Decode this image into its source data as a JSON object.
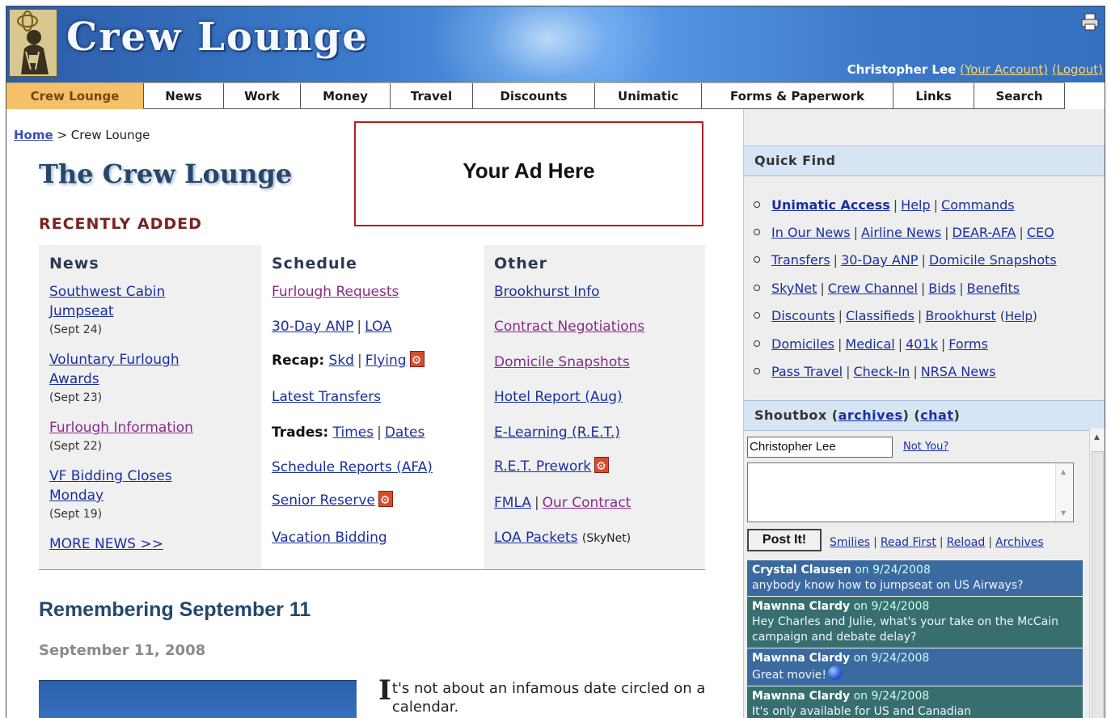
{
  "header": {
    "site_title": "Crew Lounge",
    "user_name": "Christopher Lee",
    "your_account": "(Your Account)",
    "logout": "(Logout)",
    "printer_icon": "printer-icon"
  },
  "nav": {
    "tabs": [
      {
        "label": "Crew Lounge",
        "active": true
      },
      {
        "label": "News"
      },
      {
        "label": "Work"
      },
      {
        "label": "Money"
      },
      {
        "label": "Travel"
      },
      {
        "label": "Discounts"
      },
      {
        "label": "Unimatic"
      },
      {
        "label": "Forms & Paperwork"
      },
      {
        "label": "Links"
      },
      {
        "label": "Search"
      }
    ]
  },
  "breadcrumb": {
    "home": "Home",
    "sep": " > ",
    "current": "Crew Lounge"
  },
  "ad": {
    "text": "Your Ad Here"
  },
  "main": {
    "title": "The Crew Lounge",
    "recently_added": "RECENTLY ADDED",
    "news": {
      "heading": "News",
      "items": [
        {
          "title": "Southwest Cabin Jumpseat",
          "date": "(Sept 24)"
        },
        {
          "title": "Voluntary Furlough Awards",
          "date": "(Sept 23)"
        },
        {
          "title": "Furlough Information",
          "date": "(Sept 22)"
        },
        {
          "title": "VF Bidding Closes Monday",
          "date": "(Sept 19)"
        }
      ],
      "more": "MORE NEWS >>"
    },
    "schedule": {
      "heading": "Schedule",
      "furlough_requests": "Furlough Requests",
      "anp": "30-Day ANP",
      "loa": "LOA",
      "recap_label": "Recap:",
      "recap_skd": "Skd",
      "recap_flying": "Flying",
      "latest_transfers": "Latest Transfers",
      "trades_label": "Trades:",
      "trades_times": "Times",
      "trades_dates": "Dates",
      "schedule_reports": "Schedule Reports (AFA)",
      "senior_reserve": "Senior Reserve",
      "vacation_bidding": "Vacation Bidding"
    },
    "other": {
      "heading": "Other",
      "brookhurst": "Brookhurst Info",
      "contract_neg": "Contract Negotiations",
      "domicile_snap": "Domicile Snapshots",
      "hotel_report": "Hotel Report (Aug)",
      "elearning": "E-Learning (R.E.T.)",
      "ret_prework": "R.E.T. Prework",
      "fmla": "FMLA",
      "our_contract": "Our Contract",
      "loa_packets": "LOA Packets",
      "skynet_note": "(SkyNet)"
    },
    "article": {
      "title": "Remembering September 11",
      "date": "September 11, 2008",
      "dropcap": "I",
      "text": "t's not about an infamous date circled on a calendar."
    }
  },
  "sidebar": {
    "quick_find": {
      "heading": "Quick Find",
      "rows": [
        [
          "Unimatic Access",
          "Help",
          "Commands"
        ],
        [
          "In Our News",
          "Airline News",
          "DEAR-AFA",
          "CEO"
        ],
        [
          "Transfers",
          "30-Day ANP",
          "Domicile Snapshots"
        ],
        [
          "SkyNet",
          "Crew Channel",
          "Bids",
          "Benefits"
        ],
        [
          "Discounts",
          "Classifieds",
          "Brookhurst"
        ],
        [
          "Domiciles",
          "Medical",
          "401k",
          "Forms"
        ],
        [
          "Pass Travel",
          "Check-In",
          "NRSA News"
        ]
      ],
      "brookhurst_help": "Help"
    },
    "shoutbox": {
      "heading": "Shoutbox",
      "archives": "archives",
      "chat": "chat",
      "name_value": "Christopher Lee",
      "not_you": "Not You?",
      "post_button": "Post It!",
      "links": [
        "Smilies",
        "Read First",
        "Reload",
        "Archives"
      ],
      "messages": [
        {
          "who": "Crystal Clausen",
          "on": "on 9/24/2008",
          "text": "anybody know how to jumpseat on US Airways?"
        },
        {
          "who": "Mawnna Clardy",
          "on": "on 9/24/2008",
          "text": "Hey Charles and Julie, what's your take on the McCain campaign and debate delay?"
        },
        {
          "who": "Mawnna Clardy",
          "on": "on 9/24/2008",
          "text": "Great movie!"
        },
        {
          "who": "Mawnna Clardy",
          "on": "on 9/24/2008",
          "text": "It's only available for US and Canadian"
        }
      ]
    }
  },
  "colors": {
    "nav_active": "#f5c06a",
    "link": "#1a2fa0",
    "visited": "#8a2a8a",
    "heading_blue": "#24476d",
    "recent_red": "#7a2222",
    "sidebar_header": "#d6e4f4"
  }
}
